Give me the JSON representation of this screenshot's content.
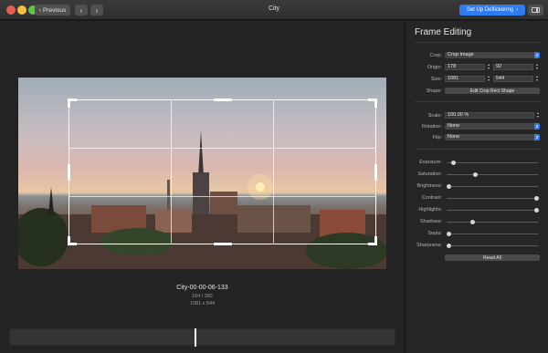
{
  "titlebar": {
    "title": "City",
    "prev_label": "Previous",
    "prev_icon": "chevron-left-icon",
    "back_icon": "chevron-left-icon",
    "forward_icon": "chevron-right-icon",
    "deflicker_label": "Set Up Deflickering",
    "deflicker_icon": "chevron-right-icon",
    "accent": "#2f7bf2"
  },
  "viewer": {
    "frame_name": "City-00-00-06-133",
    "frame_index": "164 / 382",
    "frame_dims": "1081 x 544"
  },
  "inspector": {
    "title": "Frame Editing",
    "crop": {
      "label": "Crop:",
      "value": "Crop Image"
    },
    "origin": {
      "label": "Origin:",
      "x": "178",
      "y": "92"
    },
    "size": {
      "label": "Size:",
      "w": "1081",
      "h": "544"
    },
    "shape": {
      "label": "Shape:",
      "button": "Edit Crop Rect Shape"
    },
    "scale": {
      "label": "Scale:",
      "value": "100.00 %"
    },
    "rotation": {
      "label": "Rotation:",
      "value": "None"
    },
    "flip": {
      "label": "Flip:",
      "value": "None"
    },
    "adjustments": [
      {
        "label": "Exposure:",
        "level": 0.05
      },
      {
        "label": "Saturation:",
        "level": 0.3
      },
      {
        "label": "Brightness:",
        "level": 0.0
      },
      {
        "label": "Contrast:",
        "level": 1.0
      },
      {
        "label": "Highlights:",
        "level": 1.0
      },
      {
        "label": "Shadows:",
        "level": 0.27
      },
      {
        "label": "Sepia:",
        "level": 0.0
      },
      {
        "label": "Sharpness:",
        "level": 0.0
      }
    ],
    "reset_label": "Reset All"
  }
}
